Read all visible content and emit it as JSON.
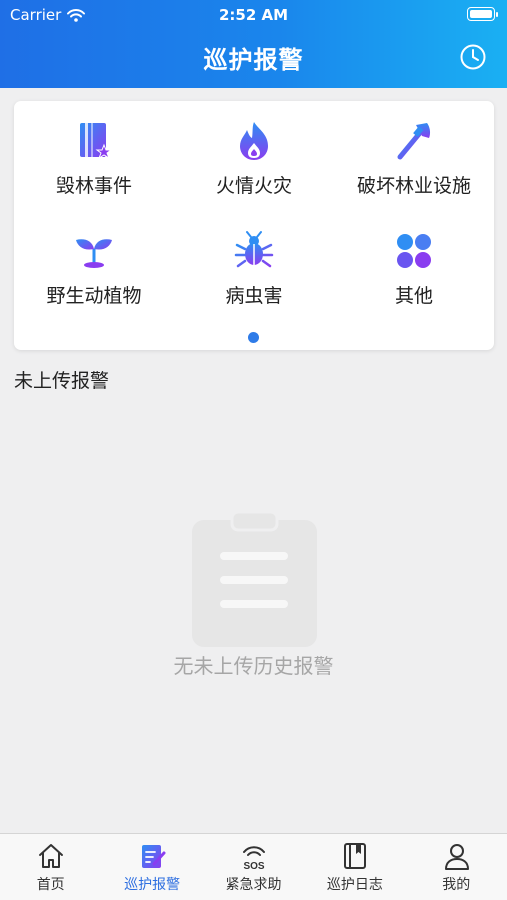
{
  "status_bar": {
    "carrier": "Carrier",
    "time": "2:52 AM"
  },
  "header": {
    "title": "巡护报警",
    "history_icon": "clock-icon"
  },
  "categories": [
    {
      "label": "毁林事件",
      "icon": "book-star-icon"
    },
    {
      "label": "火情火灾",
      "icon": "flame-icon"
    },
    {
      "label": "破坏林业设施",
      "icon": "axe-icon"
    },
    {
      "label": "野生动植物",
      "icon": "sprout-icon"
    },
    {
      "label": "病虫害",
      "icon": "bug-icon"
    },
    {
      "label": "其他",
      "icon": "grid-icon"
    }
  ],
  "pager": {
    "pages": 1,
    "current": 1
  },
  "section": {
    "title": "未上传报警"
  },
  "empty_state": {
    "text": "无未上传历史报警",
    "icon": "clipboard-icon"
  },
  "tabbar": {
    "active": 1,
    "tabs": [
      {
        "label": "首页",
        "icon": "home-icon"
      },
      {
        "label": "巡护报警",
        "icon": "edit-note-icon"
      },
      {
        "label": "紧急求助",
        "icon": "sos-icon"
      },
      {
        "label": "巡护日志",
        "icon": "notebook-icon"
      },
      {
        "label": "我的",
        "icon": "user-icon"
      }
    ]
  },
  "colors": {
    "header_start": "#1f6fe6",
    "header_end": "#1ab0f3",
    "icon_blue": "#2f8ef3",
    "icon_purple": "#8a3df0",
    "active_tab": "#2e6fe0",
    "empty_text": "#a6a6a6"
  }
}
